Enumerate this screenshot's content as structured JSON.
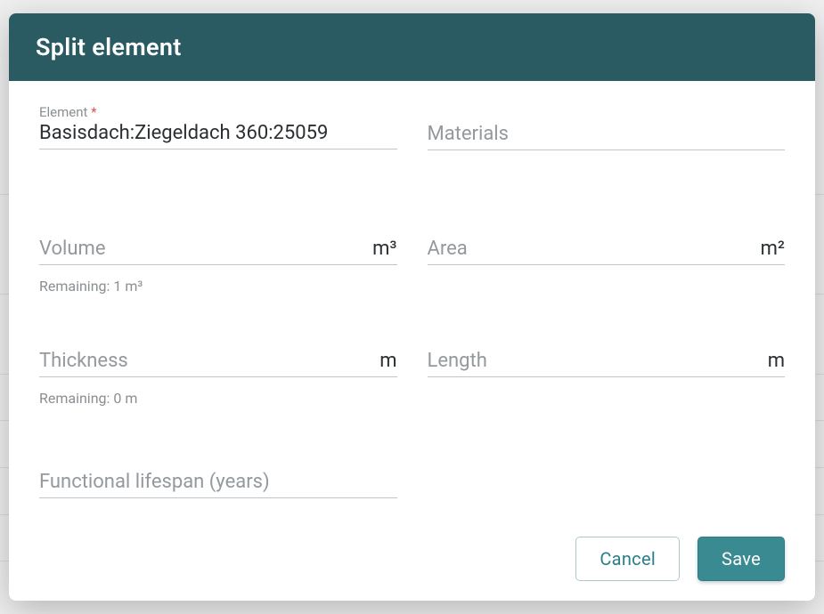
{
  "modal": {
    "title": "Split element"
  },
  "fields": {
    "element": {
      "label": "Element",
      "value": "Basisdach:Ziegeldach 360:25059"
    },
    "materials": {
      "placeholder": "Materials"
    },
    "volume": {
      "placeholder": "Volume",
      "unit": "m³",
      "helper": "Remaining: 1 m³"
    },
    "area": {
      "placeholder": "Area",
      "unit": "m²"
    },
    "thickness": {
      "placeholder": "Thickness",
      "unit": "m",
      "helper": "Remaining: 0 m"
    },
    "length_f": {
      "placeholder": "Length",
      "unit": "m"
    },
    "lifespan": {
      "placeholder": "Functional lifespan (years)"
    }
  },
  "buttons": {
    "cancel": "Cancel",
    "save": "Save"
  }
}
